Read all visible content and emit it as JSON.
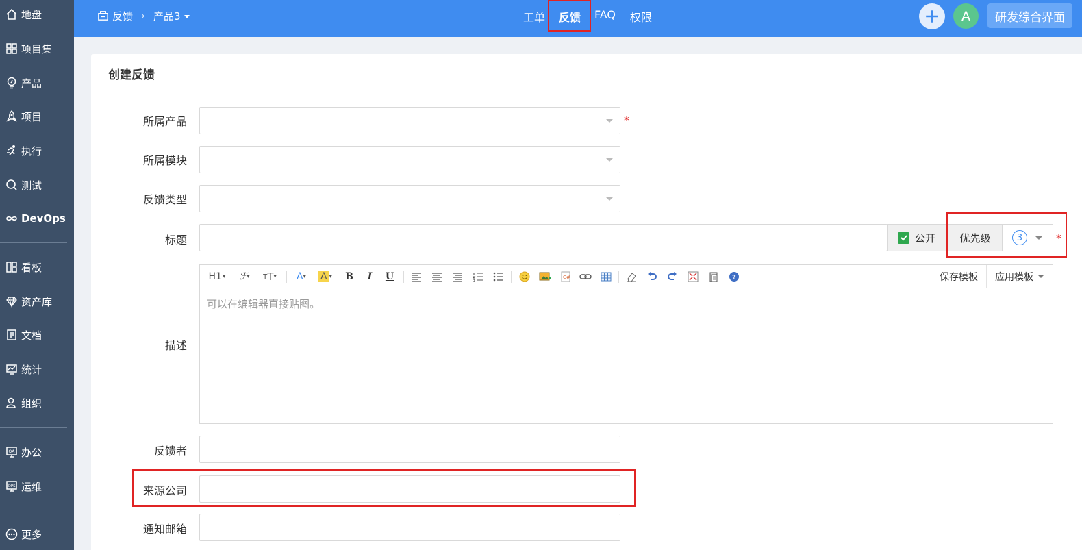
{
  "sidebar": {
    "items": [
      {
        "label": "地盘",
        "icon": "home-icon"
      },
      {
        "label": "项目集",
        "icon": "grid-icon"
      },
      {
        "label": "产品",
        "icon": "lightbulb-icon"
      },
      {
        "label": "项目",
        "icon": "rocket-icon"
      },
      {
        "label": "执行",
        "icon": "running-icon"
      },
      {
        "label": "测试",
        "icon": "search-bug-icon"
      },
      {
        "label": "DevOps",
        "icon": "infinity-icon"
      },
      {
        "label": "看板",
        "icon": "kanban-icon"
      },
      {
        "label": "资产库",
        "icon": "diamond-icon"
      },
      {
        "label": "文档",
        "icon": "document-icon"
      },
      {
        "label": "统计",
        "icon": "chart-icon"
      },
      {
        "label": "组织",
        "icon": "people-icon"
      },
      {
        "label": "办公",
        "icon": "qa-monitor-icon"
      },
      {
        "label": "运维",
        "icon": "ops-monitor-icon"
      },
      {
        "label": "更多",
        "icon": "more-icon"
      }
    ]
  },
  "header": {
    "breadcrumb_root": "反馈",
    "breadcrumb_product": "产品3",
    "tabs": [
      "工单",
      "反馈",
      "FAQ",
      "权限"
    ],
    "active_tab": "反馈",
    "avatar_letter": "A",
    "workspace_label": "研发综合界面"
  },
  "form": {
    "title": "创建反馈",
    "product_label": "所属产品",
    "module_label": "所属模块",
    "type_label": "反馈类型",
    "title_label": "标题",
    "public_label": "公开",
    "priority_label": "优先级",
    "priority_value": "3",
    "desc_label": "描述",
    "editor_placeholder": "可以在编辑器直接贴图。",
    "save_template": "保存模板",
    "apply_template": "应用模板",
    "feedback_by_label": "反馈者",
    "source_company_label": "来源公司",
    "notify_email_label": "通知邮箱",
    "required_mark": "*"
  },
  "toolbar": {
    "heading": "H1",
    "bold": "B",
    "italic": "I",
    "underline": "U"
  },
  "colors": {
    "sidebar_bg": "#3d5068",
    "topbar_bg": "#3f8cf0",
    "highlight": "#e02424",
    "checkbox": "#2fa84f"
  }
}
